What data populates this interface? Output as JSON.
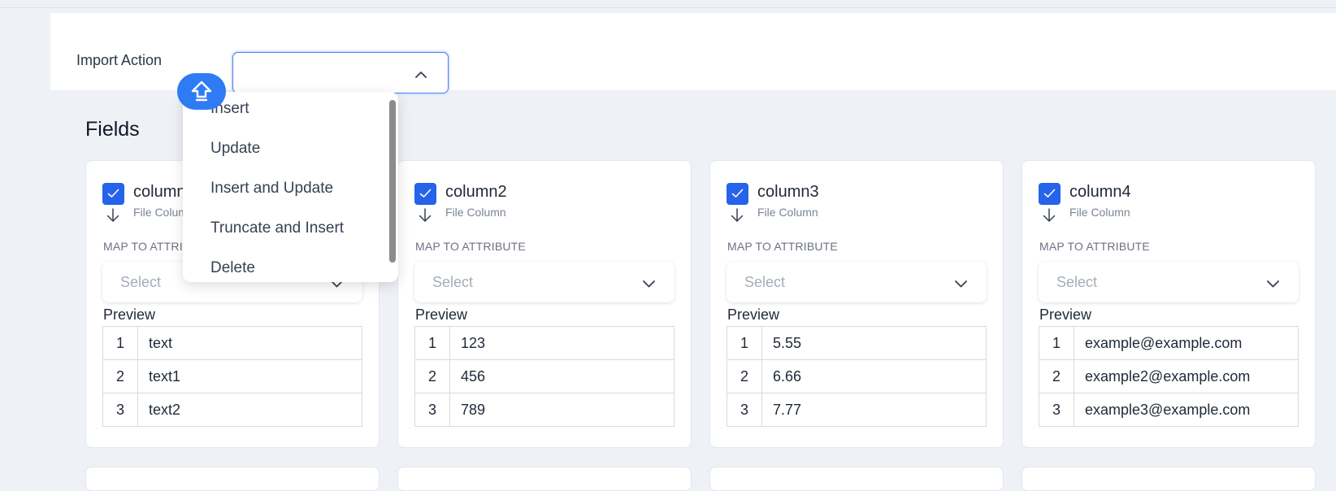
{
  "import": {
    "label": "Import Action",
    "selected_value": "",
    "options": [
      "Insert",
      "Update",
      "Insert and Update",
      "Truncate and Insert",
      "Delete"
    ]
  },
  "fields": {
    "title": "Fields",
    "cards": [
      {
        "name": "column1",
        "subtitle": "File Column",
        "map_label": "MAP TO ATTRIBUTE",
        "select_placeholder": "Select",
        "preview_label": "Preview",
        "rows": [
          [
            "1",
            "text"
          ],
          [
            "2",
            "text1"
          ],
          [
            "3",
            "text2"
          ]
        ]
      },
      {
        "name": "column2",
        "subtitle": "File Column",
        "map_label": "MAP TO ATTRIBUTE",
        "select_placeholder": "Select",
        "preview_label": "Preview",
        "rows": [
          [
            "1",
            "123"
          ],
          [
            "2",
            "456"
          ],
          [
            "3",
            "789"
          ]
        ]
      },
      {
        "name": "column3",
        "subtitle": "File Column",
        "map_label": "MAP TO ATTRIBUTE",
        "select_placeholder": "Select",
        "preview_label": "Preview",
        "rows": [
          [
            "1",
            "5.55"
          ],
          [
            "2",
            "6.66"
          ],
          [
            "3",
            "7.77"
          ]
        ]
      },
      {
        "name": "column4",
        "subtitle": "File Column",
        "map_label": "MAP TO ATTRIBUTE",
        "select_placeholder": "Select",
        "preview_label": "Preview",
        "rows": [
          [
            "1",
            "example@example.com"
          ],
          [
            "2",
            "example2@example.com"
          ],
          [
            "3",
            "example3@example.com"
          ]
        ]
      }
    ]
  },
  "icons": {
    "checkbox": "check-icon",
    "mapping": "arrow-down-icon",
    "select": "chevron-down-icon",
    "import_select": "chevron-up-icon",
    "fab": "upload-arrow-icon"
  },
  "colors": {
    "accent": "#2563eb",
    "fab": "#2f7bf5",
    "background": "#eef1f5"
  }
}
